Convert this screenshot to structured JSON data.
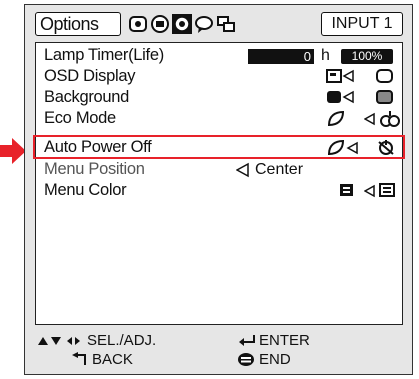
{
  "header": {
    "options_tab": "Options",
    "input_label": "INPUT 1",
    "tab_icons": [
      "picture-icon",
      "computer-icon",
      "options-icon",
      "language-icon",
      "setup-icon"
    ]
  },
  "menu": {
    "lamp_timer": {
      "label": "Lamp Timer(Life)",
      "hours": "0",
      "unit": "h",
      "percent": "100%"
    },
    "osd_display": {
      "label": "OSD Display"
    },
    "background": {
      "label": "Background"
    },
    "eco_mode": {
      "label": "Eco Mode"
    },
    "auto_power_off": {
      "label": "Auto Power Off"
    },
    "menu_position": {
      "label": "Menu Position",
      "value": "Center"
    },
    "menu_color": {
      "label": "Menu Color"
    }
  },
  "footer": {
    "sel_adj": "SEL./ADJ.",
    "enter": "ENTER",
    "back": "BACK",
    "end": "END"
  },
  "colors": {
    "highlight": "#e8222a",
    "pointer": "#e8222a"
  }
}
